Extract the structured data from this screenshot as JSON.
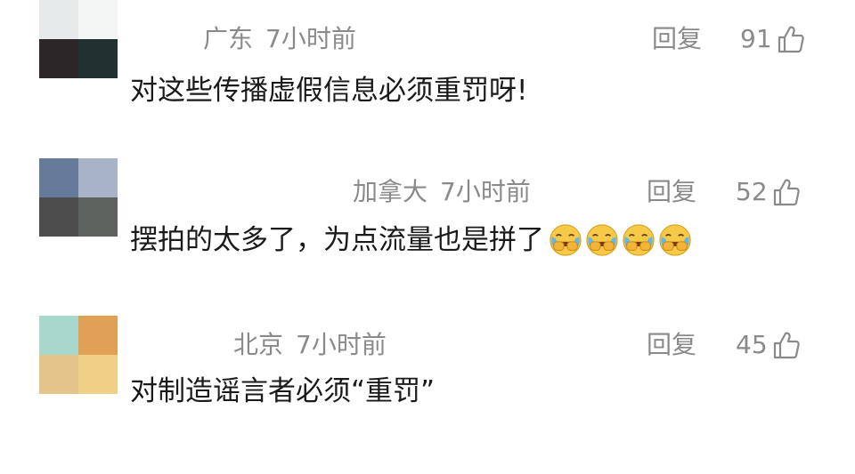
{
  "comments": [
    {
      "location": "广东",
      "time": "7小时前",
      "reply_label": "回复",
      "like_count": "91",
      "text": "对这些传播虚假信息必须重罚呀!",
      "avatar_colors": [
        "#e7eaea",
        "#f4f6f6",
        "#2c2629",
        "#233031"
      ]
    },
    {
      "location": "加拿大",
      "time": "7小时前",
      "reply_label": "回复",
      "like_count": "52",
      "text": "摆拍的太多了，为点流量也是拼了",
      "emoji": [
        "laughing-crying-emoji",
        "laughing-crying-emoji",
        "laughing-crying-emoji",
        "laughing-crying-emoji"
      ],
      "avatar_colors": [
        "#667a99",
        "#a9b3c8",
        "#4d4d4d",
        "#5d625f"
      ]
    },
    {
      "location": "北京",
      "time": "7小时前",
      "reply_label": "回复",
      "like_count": "45",
      "text": "对制造谣言者必须“重罚”",
      "avatar_colors": [
        "#a8d8cc",
        "#e0a056",
        "#e4c48b",
        "#f0cf86"
      ]
    }
  ],
  "colors": {
    "meta_text": "#8a8a8a",
    "body_text": "#1a1a1a",
    "emoji_face": "#f7c948"
  }
}
